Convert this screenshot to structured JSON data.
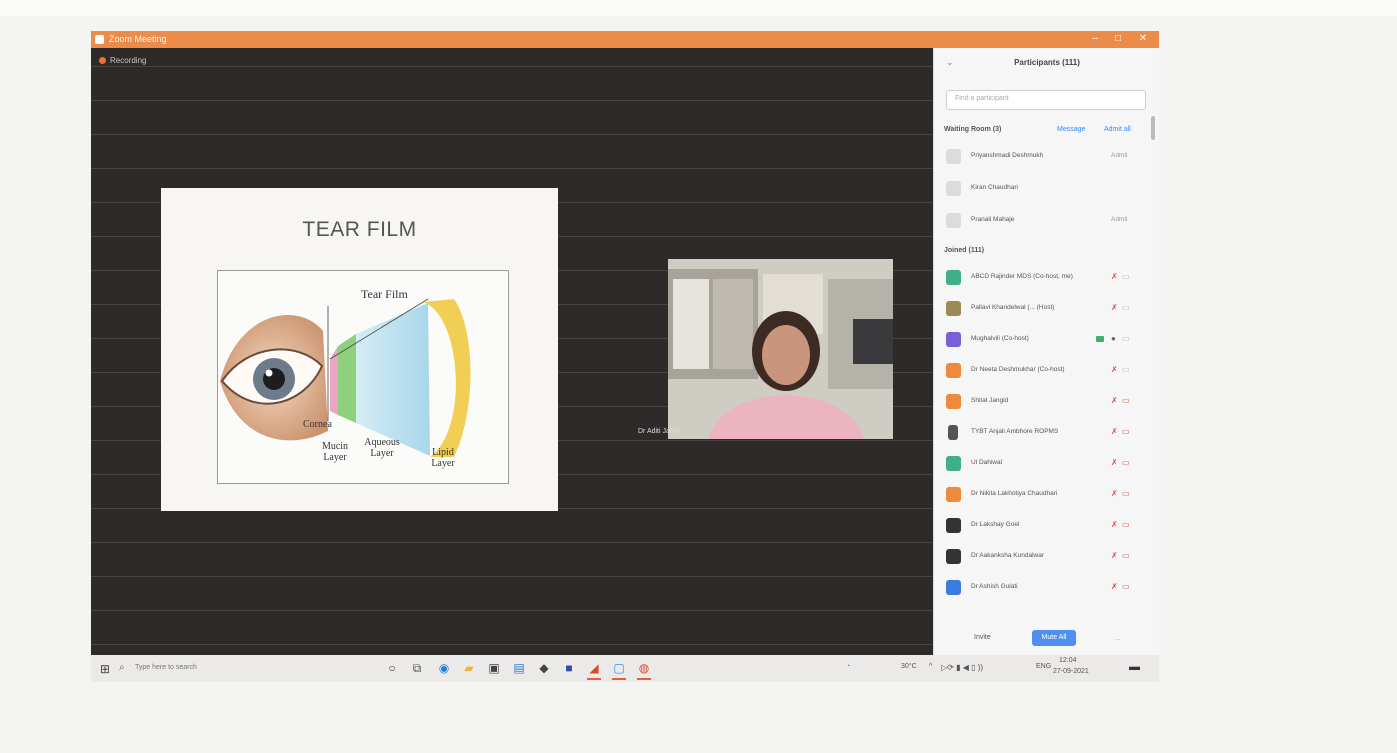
{
  "window": {
    "title": "Zoom Meeting",
    "controls": {
      "minimize": "–",
      "maximize": "□",
      "close": "✕"
    }
  },
  "meeting": {
    "recording_label": "Recording"
  },
  "slide": {
    "title": "TEAR FILM",
    "diagram": {
      "tear_film": "Tear Film",
      "cornea": "Cornea",
      "mucin_layer": "Mucin Layer",
      "aqueous_layer": "Aqueous Layer",
      "lipid_layer": "Lipid Layer"
    }
  },
  "participants_panel": {
    "title": "Participants (111)",
    "search_placeholder": "Find a participant",
    "waiting_room": {
      "label": "Waiting Room (3)",
      "message_link": "Message",
      "admit_all_link": "Admit all",
      "people": [
        {
          "name": "Priyanshmadi Deshmukh",
          "time": "Admit"
        },
        {
          "name": "Kiran Chaudhari",
          "time": ""
        },
        {
          "name": "Pranali Mahaje",
          "time": "Admit"
        }
      ]
    },
    "joined": {
      "label": "Joined (111)",
      "people": [
        {
          "name": "ABCD Rajinder MDS (Co-host, me)",
          "color": "#3fae8a",
          "video_on": false
        },
        {
          "name": "Pallavi Khandelwal (... (Host)",
          "color": "#9a8b54",
          "video_on": false
        },
        {
          "name": "Mughalvili (Co-host)",
          "color": "#7a5fd6",
          "video_on": true
        },
        {
          "name": "Dr Neeta Deshmukhar (Co-host)",
          "color": "#ef8a3c",
          "video_on": false
        },
        {
          "name": "Shital Jangid",
          "color": "#ef8a3c",
          "video_on": false
        },
        {
          "name": "TYBT Anjali Ambhore ROPMS",
          "color": "#555555",
          "video_on": false
        },
        {
          "name": "Ul Dahiwal",
          "color": "#3fae8a",
          "video_on": false
        },
        {
          "name": "Dr Nikita Lakhotiya Chaudhari",
          "color": "#ef8a3c",
          "video_on": false
        },
        {
          "name": "Dr Lakshay Goel",
          "color": "#333333",
          "video_on": false
        },
        {
          "name": "Dr Aakanksha Kundalwar",
          "color": "#333333",
          "video_on": false
        },
        {
          "name": "Dr Ashish Gulati",
          "color": "#3c7be0",
          "video_on": false
        }
      ]
    },
    "footer": {
      "invite": "Invite",
      "mute_all": "Mute All",
      "more": "..."
    }
  },
  "speaker": {
    "name": "Dr Aditi Jahal"
  },
  "taskbar": {
    "search_placeholder": "Type here to search",
    "tray": {
      "weather": "30°C",
      "lang": "ENG",
      "time": "12:04",
      "date": "27-09-2021"
    }
  },
  "colors": {
    "titlebar": "#ec8c4a",
    "accent": "#4f8ff0",
    "muted_icon": "#e04444"
  }
}
